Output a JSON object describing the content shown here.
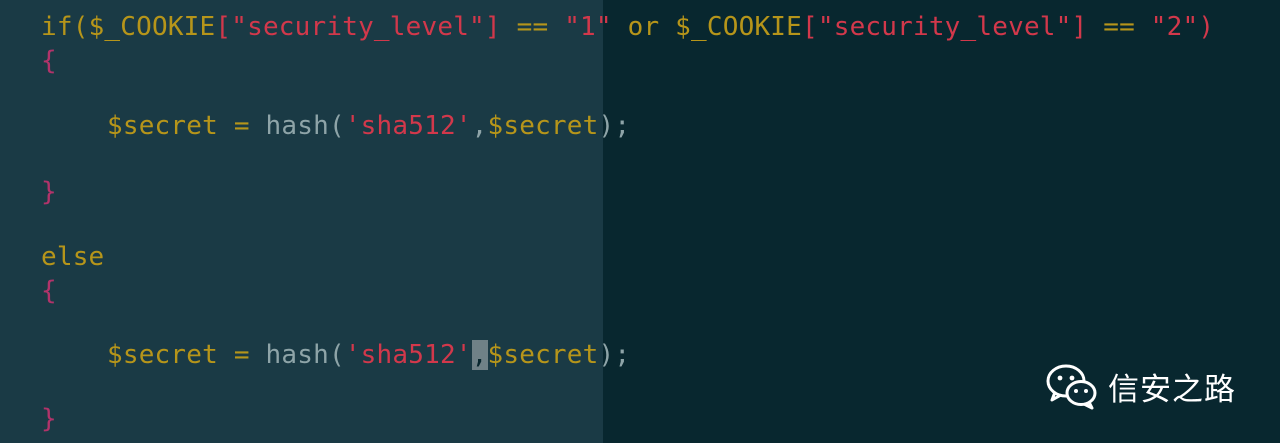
{
  "editor": {
    "lines": [
      {
        "tokens": [
          {
            "t": "if(",
            "c": "kw"
          },
          {
            "t": "$_COOKIE",
            "c": "var"
          },
          {
            "t": "[",
            "c": "str"
          },
          {
            "t": "\"security_level\"",
            "c": "str"
          },
          {
            "t": "]",
            "c": "str"
          },
          {
            "t": " == ",
            "c": "op"
          },
          {
            "t": "\"1\"",
            "c": "str"
          },
          {
            "t": " or ",
            "c": "kw"
          },
          {
            "t": "$_COOKIE",
            "c": "var"
          },
          {
            "t": "[",
            "c": "str"
          },
          {
            "t": "\"security_level\"",
            "c": "str"
          },
          {
            "t": "]",
            "c": "str"
          },
          {
            "t": " == ",
            "c": "op"
          },
          {
            "t": "\"2\"",
            "c": "str"
          },
          {
            "t": ")",
            "c": "str"
          }
        ]
      },
      {
        "tokens": [
          {
            "t": "{",
            "c": "brace"
          }
        ]
      },
      {
        "tokens": [
          {
            "t": "$secret",
            "c": "var"
          },
          {
            "t": " = ",
            "c": "op"
          },
          {
            "t": "hash(",
            "c": "plain"
          },
          {
            "t": "'sha512'",
            "c": "str"
          },
          {
            "t": ",",
            "c": "plain"
          },
          {
            "t": "$secret",
            "c": "var"
          },
          {
            "t": ");",
            "c": "plain"
          }
        ]
      },
      {
        "tokens": [
          {
            "t": "}",
            "c": "brace"
          }
        ]
      },
      {
        "tokens": [
          {
            "t": "else",
            "c": "kw"
          }
        ]
      },
      {
        "tokens": [
          {
            "t": "{",
            "c": "brace"
          }
        ]
      },
      {
        "tokens": [
          {
            "t": "$secret",
            "c": "var"
          },
          {
            "t": " = ",
            "c": "op"
          },
          {
            "t": "hash(",
            "c": "plain"
          },
          {
            "t": "'sha512'",
            "c": "str"
          },
          {
            "t": ",",
            "c": "cursor"
          },
          {
            "t": "$secret",
            "c": "var"
          },
          {
            "t": ");",
            "c": "plain"
          }
        ]
      },
      {
        "tokens": [
          {
            "t": "}",
            "c": "brace"
          }
        ]
      }
    ]
  },
  "watermark": {
    "icon": "wechat-icon",
    "text": "信安之路"
  },
  "colors": {
    "left_pane_bg": "#1a3a45",
    "right_pane_bg": "#08272f",
    "keyword": "#b6951a",
    "string": "#d2384b",
    "brace": "#b2336a",
    "plain": "#8ea4a8"
  }
}
